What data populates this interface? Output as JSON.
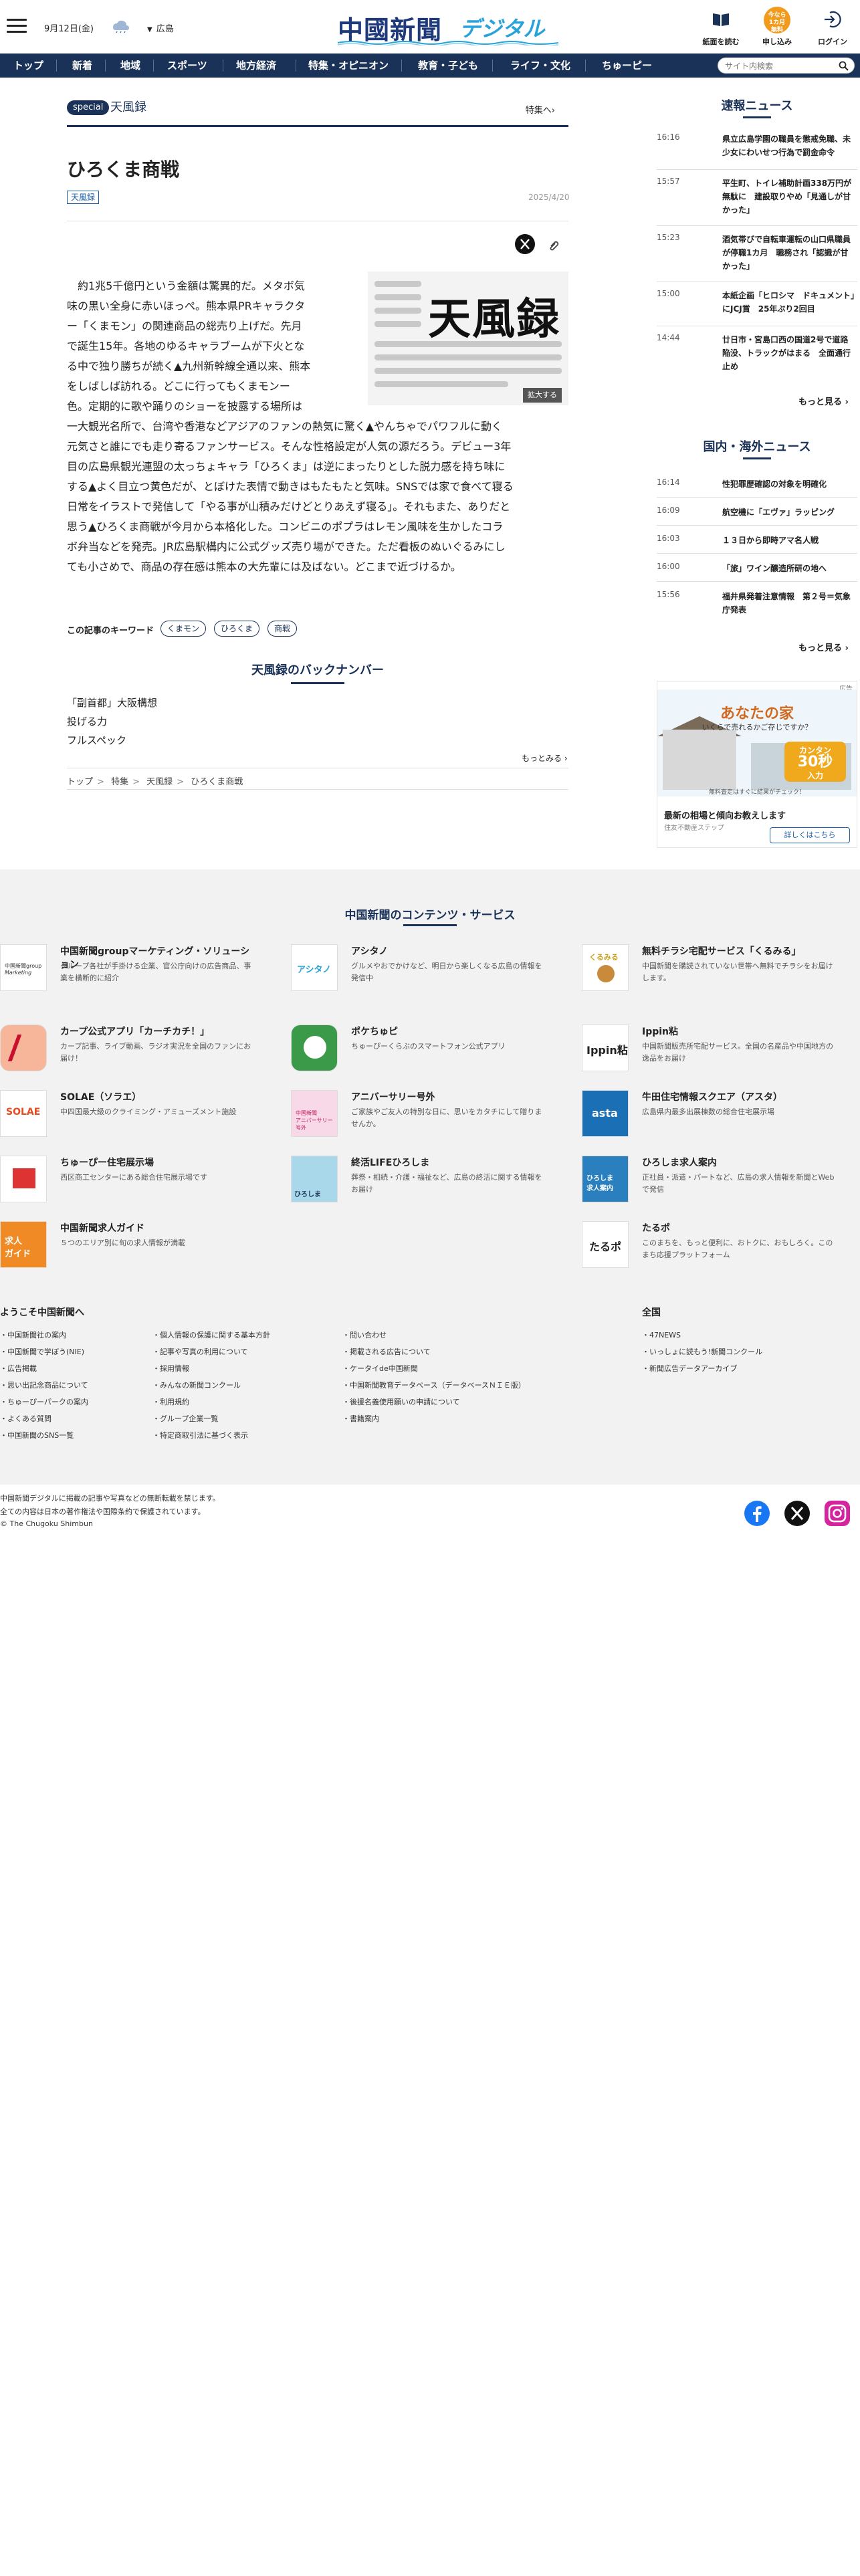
{
  "header": {
    "date": "9月12日(金)",
    "area": "広島",
    "logo_main": "中國新聞",
    "logo_sub": "デジタル",
    "btn_paper": "紙面を読む",
    "btn_apply": "申し込み",
    "btn_login": "ログイン",
    "apply_badge": "今なら\n1カ月\n無料",
    "icons": [
      "menu-icon",
      "weather-icon",
      "newspaper-icon",
      "login-icon"
    ]
  },
  "nav": {
    "items": [
      "トップ",
      "新着",
      "地域",
      "スポーツ",
      "地方経済",
      "特集・オピニオン",
      "教育・子ども",
      "ライフ・文化",
      "ちゅーピー"
    ],
    "search_placeholder": "サイト内検索"
  },
  "section": {
    "badge": "special",
    "title": "天風録",
    "link": "特集へ"
  },
  "article": {
    "title": "ひろくま商戦",
    "tag": "天風録",
    "date": "2025/4/20",
    "image_text": "天風録",
    "enlarge": "拡大する",
    "lines_wrapped": [
      "　約1兆5千億円という金額は驚異的だ。メタボ気",
      "味の黒い全身に赤いほっぺ。熊本県PRキャラクタ",
      "ー「くまモン」の関連商品の総売り上げだ。先月",
      "で誕生15年。各地のゆるキャラブームが下火とな",
      "る中で独り勝ちが続く▲九州新幹線全通以来、熊本",
      "をしばしば訪れる。どこに行ってもくまモンー",
      "色。定期的に歌や踊りのショーを披露する場所は"
    ],
    "lines_full": [
      "一大観光名所で、台湾や香港などアジアのファンの熱気に驚く▲やんちゃでパワフルに動く",
      "元気さと誰にでも走り寄るファンサービス。そんな性格設定が人気の源だろう。デビュー3年",
      "目の広島県観光連盟の太っちょキャラ「ひろくま」は逆にまったりとした脱力感を持ち味に",
      "する▲よく目立つ黄色だが、とぼけた表情で動きはもたもたと気味。SNSでは家で食べて寝る",
      "日常をイラストで発信して「やる事が山積みだけどとりあえず寝る」。それもまた、ありだと",
      "思う▲ひろくま商戦が今月から本格化した。コンビニのポプラはレモン風味を生かしたコラ",
      "ボ弁当などを発売。JR広島駅構内に公式グッズ売り場ができた。ただ看板のぬいぐるみにし",
      "ても小さめで、商品の存在感は熊本の大先輩には及ばない。どこまで近づけるか。"
    ],
    "keywords_label": "この記事のキーワード",
    "keywords": [
      "くまモン",
      "ひろくま",
      "商戦"
    ]
  },
  "backnumber": {
    "title": "天風録のバックナンバー",
    "items": [
      "「副首都」大阪構想",
      "投げる力",
      "フルスペック"
    ],
    "more": "もっとみる"
  },
  "breadcrumb": [
    "トップ",
    "特集",
    "天風録",
    "ひろくま商戦"
  ],
  "breaking": {
    "title": "速報ニュース",
    "items": [
      {
        "time": "16:16",
        "headline": "県立広島学園の職員を懲戒免職、未少女にわいせつ行為で罰金命令"
      },
      {
        "time": "15:57",
        "headline": "平生町、トイレ補助計画338万円が無駄に　建設取りやめ「見通しが甘かった」"
      },
      {
        "time": "15:23",
        "headline": "酒気帯びで自転車運転の山口県職員が停職1カ月　職務され「認識が甘かった」"
      },
      {
        "time": "15:00",
        "headline": "本紙企画「ヒロシマ　ドキュメント」にJCJ賞　25年ぶり2回目"
      },
      {
        "time": "14:44",
        "headline": "廿日市・宮島口西の国道2号で道路陥没、トラックがはまる　全面通行止め"
      }
    ],
    "more": "もっと見る"
  },
  "national": {
    "title": "国内・海外ニュース",
    "items": [
      {
        "time": "16:14",
        "headline": "性犯罪歴確認の対象を明確化"
      },
      {
        "time": "16:09",
        "headline": "航空機に「エヴァ」ラッピング"
      },
      {
        "time": "16:03",
        "headline": "１３日から即時アマ名人戦"
      },
      {
        "time": "16:00",
        "headline": "「旅」ワイン醸造所研の地へ"
      },
      {
        "time": "15:56",
        "headline": "福井県発着注意情報　第２号＝気象庁発表"
      }
    ],
    "more": "もっと見る"
  },
  "ad": {
    "label": "広告",
    "headline": "あなたの家",
    "subline": "いくらで売れるかご存じですか？",
    "badge_top": "カンタン",
    "badge_big": "30秒",
    "badge_bottom": "入力",
    "caption": "無料査定はすぐに結果がチェック！",
    "title": "最新の相場と傾向お教えします",
    "sub": "住友不動産ステップ",
    "button": "詳しくはこちら"
  },
  "footer": {
    "services_title": "中国新聞のコンテンツ・サービス",
    "services": [
      {
        "name": "中国新聞groupマーケティング・ソリューション",
        "desc": "グループ各社が手掛ける企業、官公庁向けの広告商品、事業を横断的に紹介"
      },
      {
        "name": "アシタノ",
        "desc": "グルメやおでかけなど、明日から楽しくなる広島の情報を発信中"
      },
      {
        "name": "無料チラシ宅配サービス「くるみる」",
        "desc": "中国新聞を購読されていない世帯へ無料でチラシをお届けします。"
      },
      {
        "name": "カープ公式アプリ「カーチカチ！」",
        "desc": "カープ記事、ライブ動画、ラジオ実況を全国のファンにお届け！"
      },
      {
        "name": "ポケちゅピ",
        "desc": "ちゅーぴーくらぶのスマートフォン公式アプリ"
      },
      {
        "name": "Ippin粘",
        "desc": "中国新聞販売所宅配サービス。全国の名産品や中国地方の逸品をお届け"
      },
      {
        "name": "SOLAE（ソラエ）",
        "desc": "中四国最大級のクライミング・アミューズメント施設"
      },
      {
        "name": "アニバーサリー号外",
        "desc": "ご家族やご友人の特別な日に、思いをカタチにして贈りませんか。"
      },
      {
        "name": "牛田住宅情報スクエア（アスタ）",
        "desc": "広島県内最多出展棟数の総合住宅展示場"
      },
      {
        "name": "ちゅーぴー住宅展示場",
        "desc": "西区商工センターにある総合住宅展示場です"
      },
      {
        "name": "終活LIFEひろしま",
        "desc": "葬祭・相続・介護・福祉など、広島の終活に関する情報をお届け"
      },
      {
        "name": "ひろしま求人案内",
        "desc": "正社員・派遣・パートなど、広島の求人情報を新聞とWebで発信"
      },
      {
        "name": "中国新聞求人ガイド",
        "desc": "５つのエリア別に旬の求人情報が満載"
      },
      {
        "name": "",
        "desc": ""
      },
      {
        "name": "たるポ",
        "desc": "このまちを、もっと便利に、おトクに、おもしろく。このまち応援プラットフォーム"
      }
    ],
    "welcome_title": "ようこそ中国新聞へ",
    "welcome_col1": [
      "中国新聞社の案内",
      "中国新聞で学ぼう(NIE)",
      "広告掲載",
      "思い出記念商品について",
      "ちゅーぴーパークの案内",
      "よくある質問",
      "中国新聞のSNS一覧"
    ],
    "welcome_col2": [
      "個人情報の保護に関する基本方針",
      "記事や写真の利用について",
      "採用情報",
      "みんなの新聞コンクール",
      "利用規約",
      "グループ企業一覧",
      "特定商取引法に基づく表示"
    ],
    "welcome_col3": [
      "問い合わせ",
      "掲載される広告について",
      "ケータイde中国新聞",
      "中国新聞教育データベース（データベースＮＩＥ版）",
      "後援名義使用願いの申請について",
      "書籍案内"
    ],
    "national_title": "全国",
    "national_links": [
      "47NEWS",
      "いっしょに読もう!新聞コンクール",
      "新聞広告データアーカイブ"
    ],
    "copy1": "中国新聞デジタルに掲載の記事や写真などの無断転載を禁じます。",
    "copy2": "全ての内容は日本の著作権法や国際条約で保護されています。",
    "copy3": "© The Chugoku Shimbun",
    "sns_icons": [
      "facebook-icon",
      "x-icon",
      "instagram-icon"
    ]
  },
  "colors": {
    "navy": "#1a3257",
    "orange": "#f29a1c",
    "logo_blue": "#1e3a7a",
    "logo_cyan": "#27a3d9"
  }
}
